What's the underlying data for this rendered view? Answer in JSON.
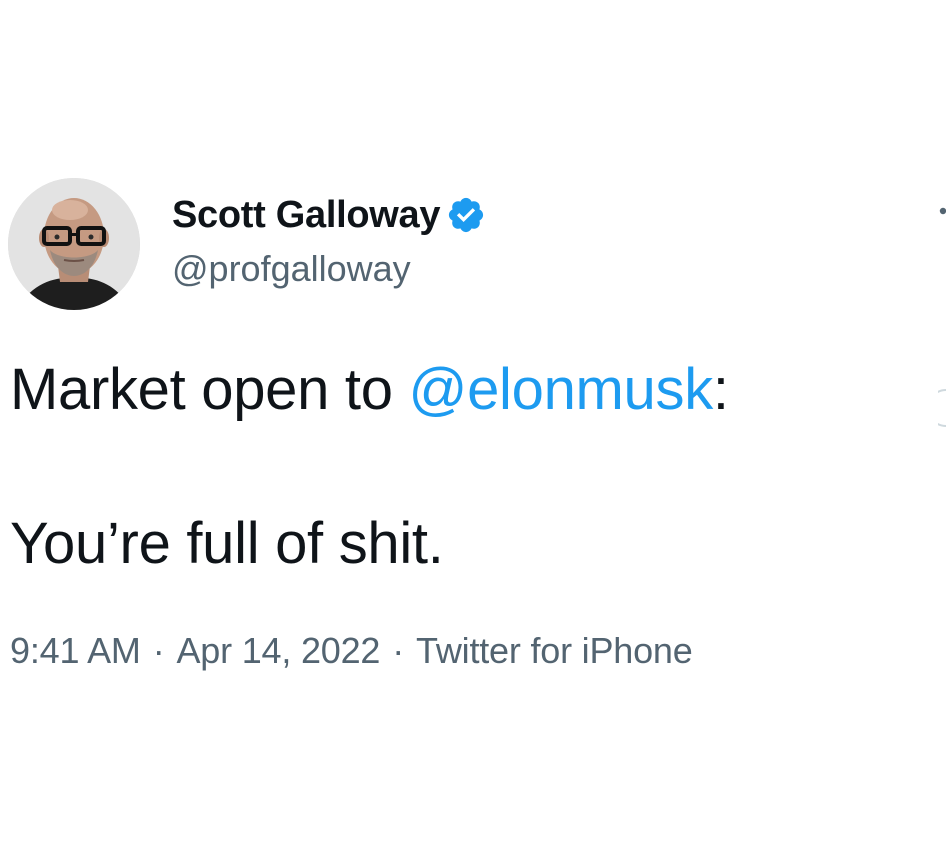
{
  "author": {
    "display_name": "Scott Galloway",
    "handle": "@profgalloway",
    "verified": true,
    "verified_color": "#1d9bf0"
  },
  "tweet": {
    "line1_prefix": "Market open to ",
    "mention": "@elonmusk",
    "line1_suffix": ":",
    "line2": "You’re full of shit."
  },
  "meta": {
    "time": "9:41 AM",
    "separator": "·",
    "date": "Apr 14, 2022",
    "source": "Twitter for iPhone"
  },
  "colors": {
    "text": "#0f1419",
    "secondary": "#536471",
    "link": "#1d9bf0"
  },
  "icons": {
    "avatar": "avatar",
    "verified": "verified-badge-icon",
    "more": "more-options-icon"
  }
}
